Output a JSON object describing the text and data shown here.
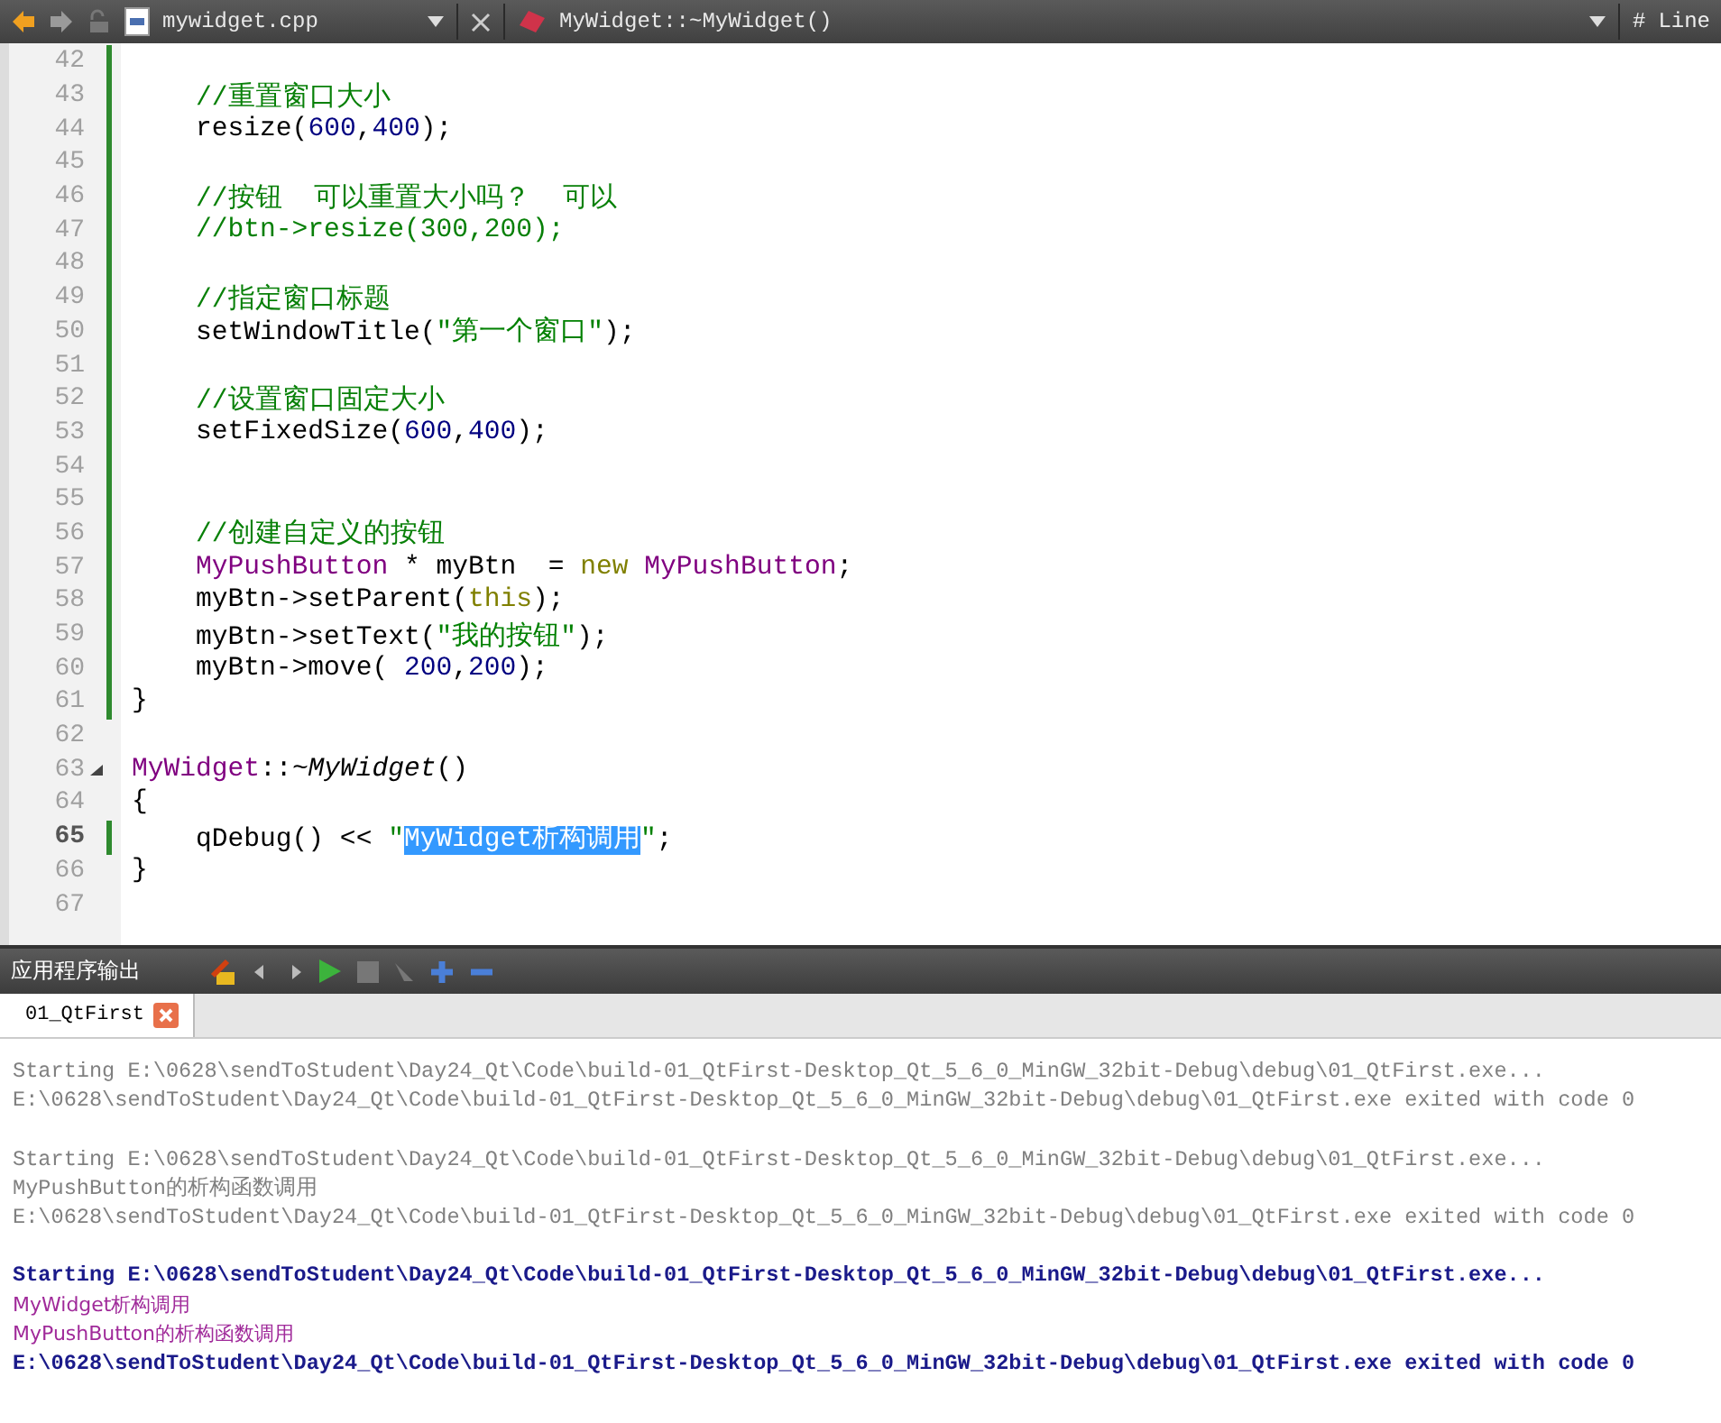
{
  "editor_toolbar": {
    "file_name": "mywidget.cpp",
    "symbol": "MyWidget::~MyWidget()",
    "hash_label": "#",
    "line_label": "Line"
  },
  "code_lines": [
    {
      "number": "42",
      "changed": true,
      "current": false,
      "fold": false
    },
    {
      "number": "43",
      "changed": true,
      "current": false,
      "fold": false,
      "tokens": [
        {
          "text": "    //重置窗口大小",
          "kind": "comment"
        }
      ]
    },
    {
      "number": "44",
      "changed": true,
      "current": false,
      "fold": false,
      "tokens": [
        {
          "text": "    resize(",
          "kind": "plain"
        },
        {
          "text": "600",
          "kind": "number"
        },
        {
          "text": ",",
          "kind": "plain"
        },
        {
          "text": "400",
          "kind": "number"
        },
        {
          "text": ");",
          "kind": "plain"
        }
      ]
    },
    {
      "number": "45",
      "changed": true,
      "current": false,
      "fold": false
    },
    {
      "number": "46",
      "changed": true,
      "current": false,
      "fold": false,
      "tokens": [
        {
          "text": "    //按钮  可以重置大小吗？  可以",
          "kind": "comment"
        }
      ]
    },
    {
      "number": "47",
      "changed": true,
      "current": false,
      "fold": false,
      "tokens": [
        {
          "text": "    //btn->resize(300,200);",
          "kind": "comment"
        }
      ]
    },
    {
      "number": "48",
      "changed": true,
      "current": false,
      "fold": false
    },
    {
      "number": "49",
      "changed": true,
      "current": false,
      "fold": false,
      "tokens": [
        {
          "text": "    //指定窗口标题",
          "kind": "comment"
        }
      ]
    },
    {
      "number": "50",
      "changed": true,
      "current": false,
      "fold": false,
      "tokens": [
        {
          "text": "    setWindowTitle(",
          "kind": "plain"
        },
        {
          "text": "\"第一个窗口\"",
          "kind": "string"
        },
        {
          "text": ");",
          "kind": "plain"
        }
      ]
    },
    {
      "number": "51",
      "changed": true,
      "current": false,
      "fold": false
    },
    {
      "number": "52",
      "changed": true,
      "current": false,
      "fold": false,
      "tokens": [
        {
          "text": "    //设置窗口固定大小",
          "kind": "comment"
        }
      ]
    },
    {
      "number": "53",
      "changed": true,
      "current": false,
      "fold": false,
      "tokens": [
        {
          "text": "    setFixedSize(",
          "kind": "plain"
        },
        {
          "text": "600",
          "kind": "number"
        },
        {
          "text": ",",
          "kind": "plain"
        },
        {
          "text": "400",
          "kind": "number"
        },
        {
          "text": ");",
          "kind": "plain"
        }
      ]
    },
    {
      "number": "54",
      "changed": true,
      "current": false,
      "fold": false
    },
    {
      "number": "55",
      "changed": true,
      "current": false,
      "fold": false
    },
    {
      "number": "56",
      "changed": true,
      "current": false,
      "fold": false,
      "tokens": [
        {
          "text": "    //创建自定义的按钮",
          "kind": "comment"
        }
      ]
    },
    {
      "number": "57",
      "changed": true,
      "current": false,
      "fold": false,
      "tokens": [
        {
          "text": "    MyPushButton",
          "kind": "type"
        },
        {
          "text": " * myBtn  = ",
          "kind": "plain"
        },
        {
          "text": "new",
          "kind": "keyword"
        },
        {
          "text": " MyPushButton",
          "kind": "type"
        },
        {
          "text": ";",
          "kind": "plain"
        }
      ]
    },
    {
      "number": "58",
      "changed": true,
      "current": false,
      "fold": false,
      "tokens": [
        {
          "text": "    myBtn->setParent(",
          "kind": "plain"
        },
        {
          "text": "this",
          "kind": "keyword"
        },
        {
          "text": ");",
          "kind": "plain"
        }
      ]
    },
    {
      "number": "59",
      "changed": true,
      "current": false,
      "fold": false,
      "tokens": [
        {
          "text": "    myBtn->setText(",
          "kind": "plain"
        },
        {
          "text": "\"我的按钮\"",
          "kind": "string"
        },
        {
          "text": ");",
          "kind": "plain"
        }
      ]
    },
    {
      "number": "60",
      "changed": true,
      "current": false,
      "fold": false,
      "tokens": [
        {
          "text": "    myBtn->move( ",
          "kind": "plain"
        },
        {
          "text": "200",
          "kind": "number"
        },
        {
          "text": ",",
          "kind": "plain"
        },
        {
          "text": "200",
          "kind": "number"
        },
        {
          "text": ");",
          "kind": "plain"
        }
      ]
    },
    {
      "number": "61",
      "changed": true,
      "current": false,
      "fold": false,
      "tokens": [
        {
          "text": "}",
          "kind": "plain"
        }
      ]
    },
    {
      "number": "62",
      "changed": false,
      "current": false,
      "fold": false
    },
    {
      "number": "63",
      "changed": false,
      "current": false,
      "fold": true,
      "tokens": [
        {
          "text": "MyWidget",
          "kind": "type"
        },
        {
          "text": "::",
          "kind": "plain"
        },
        {
          "text": "~MyWidget",
          "kind": "italic"
        },
        {
          "text": "()",
          "kind": "plain"
        }
      ]
    },
    {
      "number": "64",
      "changed": false,
      "current": false,
      "fold": false,
      "tokens": [
        {
          "text": "{",
          "kind": "plain"
        }
      ]
    },
    {
      "number": "65",
      "changed": true,
      "current": true,
      "fold": false,
      "tokens": [
        {
          "text": "    qDebug() << ",
          "kind": "plain"
        },
        {
          "text": "\"",
          "kind": "string"
        },
        {
          "text": "MyWidget析构调用",
          "kind": "selected"
        },
        {
          "text": "\"",
          "kind": "string"
        },
        {
          "text": ";",
          "kind": "plain"
        }
      ]
    },
    {
      "number": "66",
      "changed": false,
      "current": false,
      "fold": false,
      "tokens": [
        {
          "text": "}",
          "kind": "plain"
        }
      ]
    },
    {
      "number": "67",
      "changed": false,
      "current": false,
      "fold": false
    }
  ],
  "output_pane": {
    "title": "应用程序输出",
    "tabs": [
      {
        "label": "01_QtFirst",
        "selected": true
      }
    ],
    "groups": [
      [
        {
          "text": "Starting E:\\0628\\sendToStudent\\Day24_Qt\\Code\\build-01_QtFirst-Desktop_Qt_5_6_0_MinGW_32bit-Debug\\debug\\01_QtFirst.exe...",
          "kind": "old"
        },
        {
          "text": "E:\\0628\\sendToStudent\\Day24_Qt\\Code\\build-01_QtFirst-Desktop_Qt_5_6_0_MinGW_32bit-Debug\\debug\\01_QtFirst.exe exited with code 0",
          "kind": "old"
        }
      ],
      [
        {
          "text": "Starting E:\\0628\\sendToStudent\\Day24_Qt\\Code\\build-01_QtFirst-Desktop_Qt_5_6_0_MinGW_32bit-Debug\\debug\\01_QtFirst.exe...",
          "kind": "old"
        },
        {
          "text": "MyPushButton的析构函数调用",
          "kind": "old"
        },
        {
          "text": "E:\\0628\\sendToStudent\\Day24_Qt\\Code\\build-01_QtFirst-Desktop_Qt_5_6_0_MinGW_32bit-Debug\\debug\\01_QtFirst.exe exited with code 0",
          "kind": "old"
        }
      ],
      [
        {
          "text": "Starting E:\\0628\\sendToStudent\\Day24_Qt\\Code\\build-01_QtFirst-Desktop_Qt_5_6_0_MinGW_32bit-Debug\\debug\\01_QtFirst.exe...",
          "kind": "status"
        },
        {
          "text": "MyWidget析构调用",
          "kind": "debug"
        },
        {
          "text": "MyPushButton的析构函数调用",
          "kind": "debug"
        },
        {
          "text": "E:\\0628\\sendToStudent\\Day24_Qt\\Code\\build-01_QtFirst-Desktop_Qt_5_6_0_MinGW_32bit-Debug\\debug\\01_QtFirst.exe exited with code 0",
          "kind": "status"
        }
      ]
    ]
  }
}
